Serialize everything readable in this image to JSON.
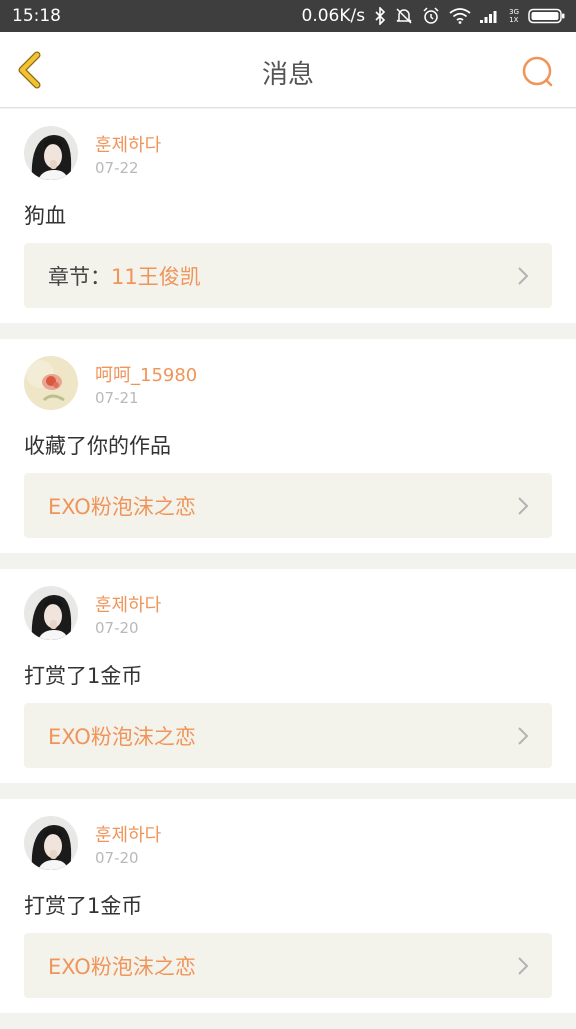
{
  "status_bar": {
    "time": "15:18",
    "speed": "0.06K/s",
    "network_top": "3G",
    "network_bottom": "1X",
    "icons": [
      "bluetooth-icon",
      "mute-icon",
      "alarm-icon",
      "wifi-icon",
      "signal-icon",
      "battery-icon"
    ]
  },
  "header": {
    "title": "消息",
    "back_icon": "chevron-left-icon",
    "search_icon": "search-icon"
  },
  "colors": {
    "accent": "#f0955a",
    "back_yellow": "#f2c230"
  },
  "messages": [
    {
      "user": "훈제하다",
      "date": "07-22",
      "text": "狗血",
      "link_prefix": "章节：",
      "link_title": "11王俊凯",
      "avatar": "girl-photo"
    },
    {
      "user": "呵呵_15980",
      "date": "07-21",
      "text": "收藏了你的作品",
      "link_prefix": "",
      "link_title": "EXO粉泡沫之恋",
      "avatar": "flower-photo"
    },
    {
      "user": "훈제하다",
      "date": "07-20",
      "text": "打赏了1金币",
      "link_prefix": "",
      "link_title": "EXO粉泡沫之恋",
      "avatar": "girl-photo"
    },
    {
      "user": "훈제하다",
      "date": "07-20",
      "text": "打赏了1金币",
      "link_prefix": "",
      "link_title": "EXO粉泡沫之恋",
      "avatar": "girl-photo"
    }
  ]
}
